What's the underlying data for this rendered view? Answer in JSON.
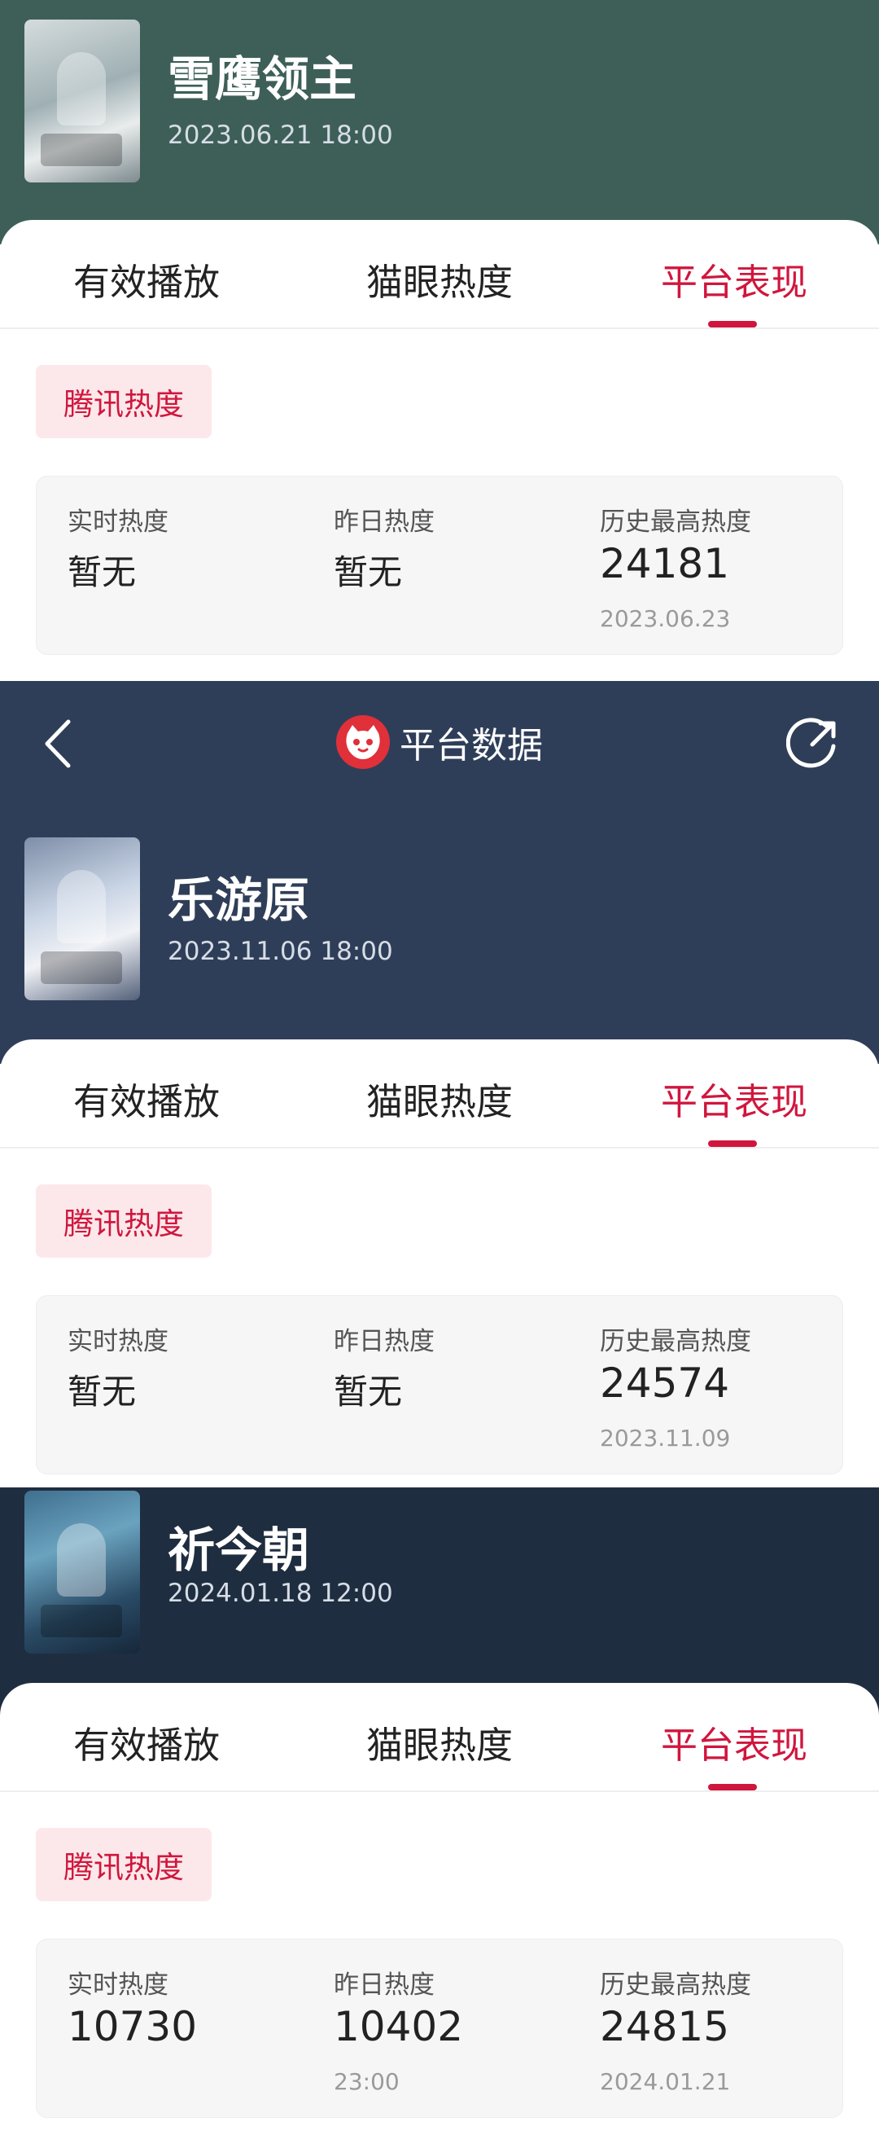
{
  "nav": {
    "title": "平台数据",
    "back_icon": "chevron-left-icon",
    "share_icon": "share-icon",
    "logo_icon": "maoyan-cat-icon"
  },
  "tabs": [
    "有效播放",
    "猫眼热度",
    "平台表现"
  ],
  "active_tab": "平台表现",
  "accent_color": "#d0163d",
  "shows": [
    {
      "title": "雪鹰领主",
      "datetime": "2023.06.21 18:00",
      "platform": "腾讯热度",
      "stats": [
        {
          "label": "实时热度",
          "value": "暂无",
          "sub": ""
        },
        {
          "label": "昨日热度",
          "value": "暂无",
          "sub": ""
        },
        {
          "label": "历史最高热度",
          "value": "24181",
          "sub": "2023.06.23"
        }
      ]
    },
    {
      "title": "乐游原",
      "datetime": "2023.11.06 18:00",
      "platform": "腾讯热度",
      "stats": [
        {
          "label": "实时热度",
          "value": "暂无",
          "sub": ""
        },
        {
          "label": "昨日热度",
          "value": "暂无",
          "sub": ""
        },
        {
          "label": "历史最高热度",
          "value": "24574",
          "sub": "2023.11.09"
        }
      ]
    },
    {
      "title": "祈今朝",
      "datetime": "2024.01.18 12:00",
      "platform": "腾讯热度",
      "stats": [
        {
          "label": "实时热度",
          "value": "10730",
          "sub": ""
        },
        {
          "label": "昨日热度",
          "value": "10402",
          "sub": "23:00"
        },
        {
          "label": "历史最高热度",
          "value": "24815",
          "sub": "2024.01.21"
        }
      ]
    }
  ]
}
